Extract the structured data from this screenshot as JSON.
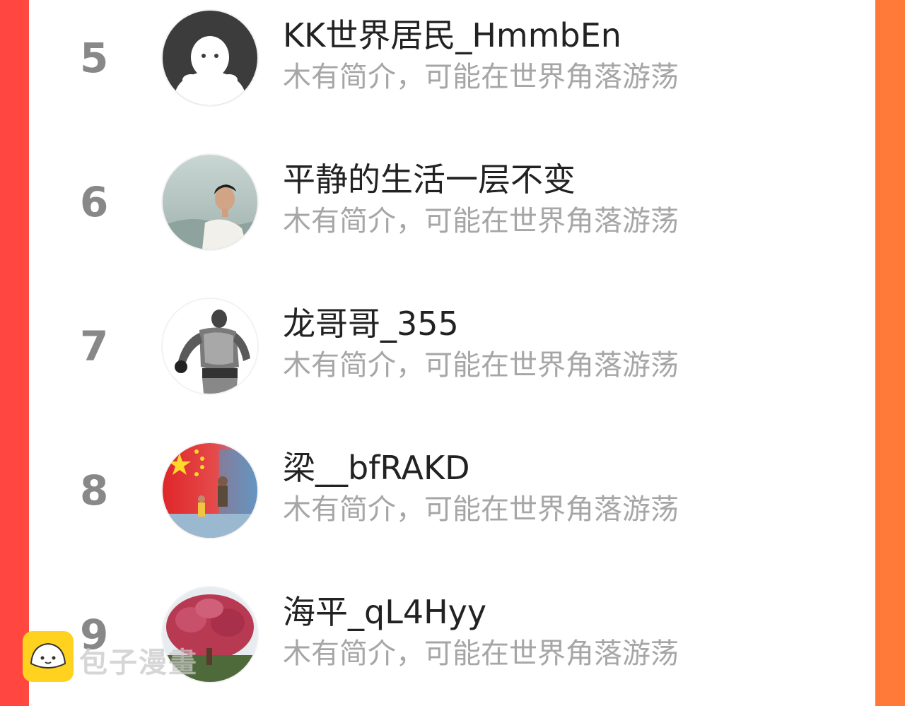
{
  "list": {
    "items": [
      {
        "rank": "5",
        "name": "KK世界居民_HmmbEn",
        "bio": "木有简介，可能在世界角落游荡",
        "avatar": "default-ghost-avatar"
      },
      {
        "rank": "6",
        "name": "平静的生活一层不变",
        "bio": "木有简介，可能在世界角落游荡",
        "avatar": "man-photo-avatar"
      },
      {
        "rank": "7",
        "name": "龙哥哥_355",
        "bio": "木有简介，可能在世界角落游荡",
        "avatar": "tattoo-sketch-avatar"
      },
      {
        "rank": "8",
        "name": "梁__bfRAKD",
        "bio": "木有简介，可能在世界角落游荡",
        "avatar": "flag-photo-avatar"
      },
      {
        "rank": "9",
        "name": "海平_qL4Hyy",
        "bio": "木有简介，可能在世界角落游荡",
        "avatar": "flower-tree-avatar"
      }
    ]
  },
  "watermark": {
    "text": "包子漫畫",
    "icon": "bun-icon"
  },
  "colors": {
    "accent": "#ff5a3c",
    "rank": "#888888",
    "bio": "#a6a6a6",
    "name": "#222222"
  }
}
